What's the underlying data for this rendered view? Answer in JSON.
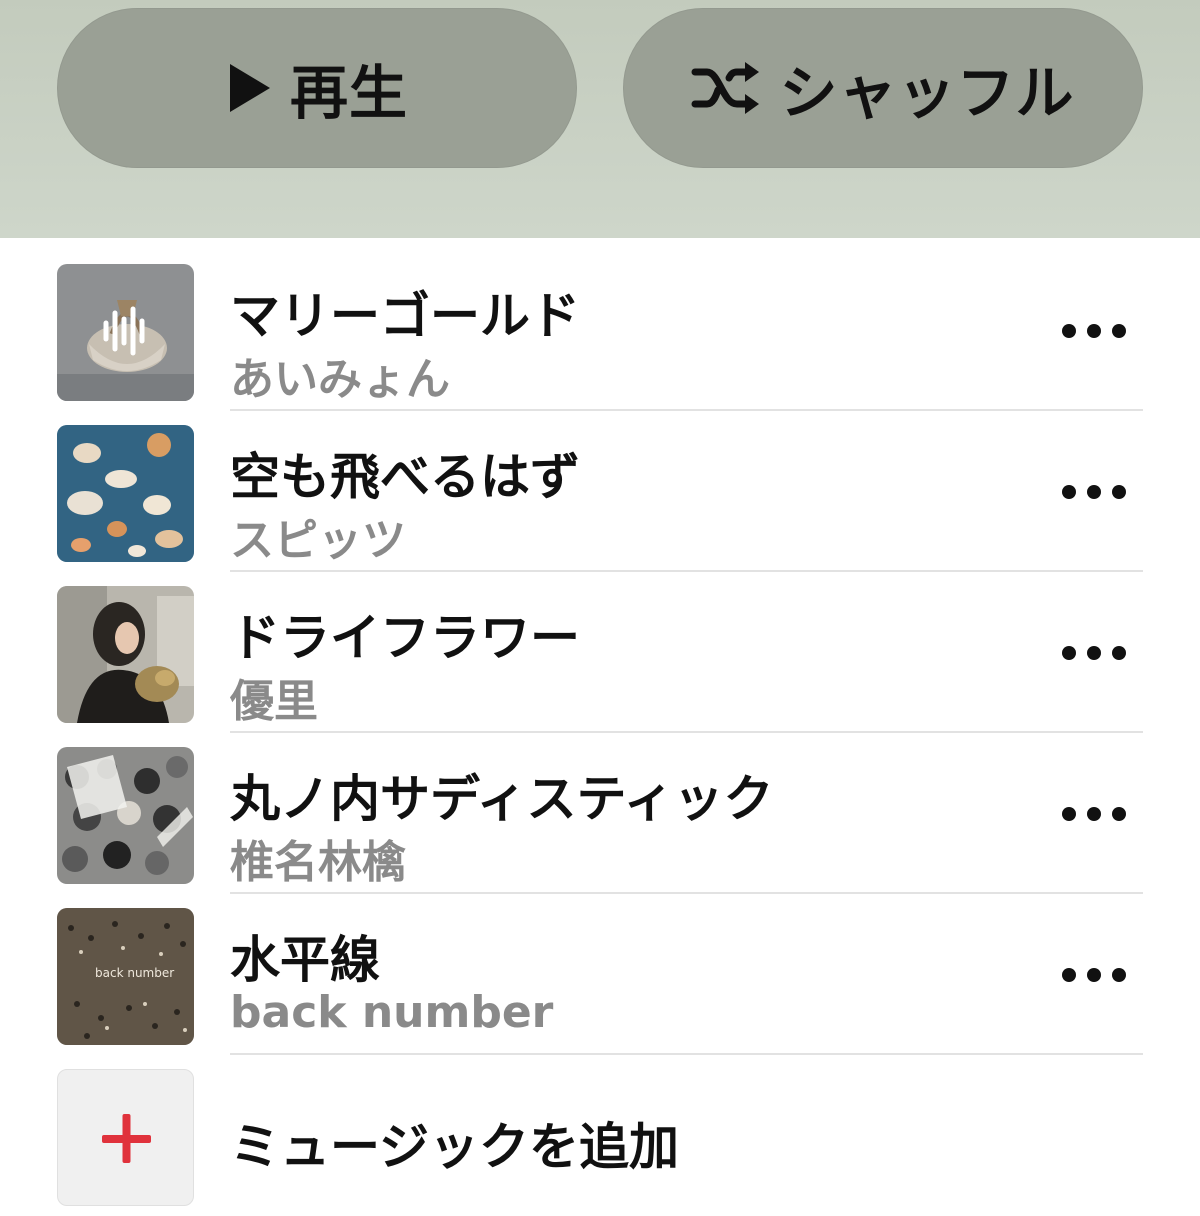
{
  "header": {
    "play_label": "再生",
    "shuffle_label": "シャッフル"
  },
  "tracks": [
    {
      "title": "マリーゴールド",
      "artist": "あいみょん",
      "now_playing": true
    },
    {
      "title": "空も飛べるはず",
      "artist": "スピッツ"
    },
    {
      "title": "ドライフラワー",
      "artist": "優里"
    },
    {
      "title": "丸ノ内サディスティック",
      "artist": "椎名林檎"
    },
    {
      "title": "水平線",
      "artist": "back number",
      "cover_text": "back number"
    }
  ],
  "add_music": {
    "label": "ミュージックを追加"
  },
  "icons": {
    "play": "play-icon",
    "shuffle": "shuffle-icon",
    "more": "ellipsis-icon",
    "now_playing": "waveform-icon",
    "add": "plus-icon"
  },
  "colors": {
    "accent": "#e0323c",
    "pill": "#9aa095",
    "header": "#c9d1c4",
    "secondary_text": "#8a8a8a"
  }
}
